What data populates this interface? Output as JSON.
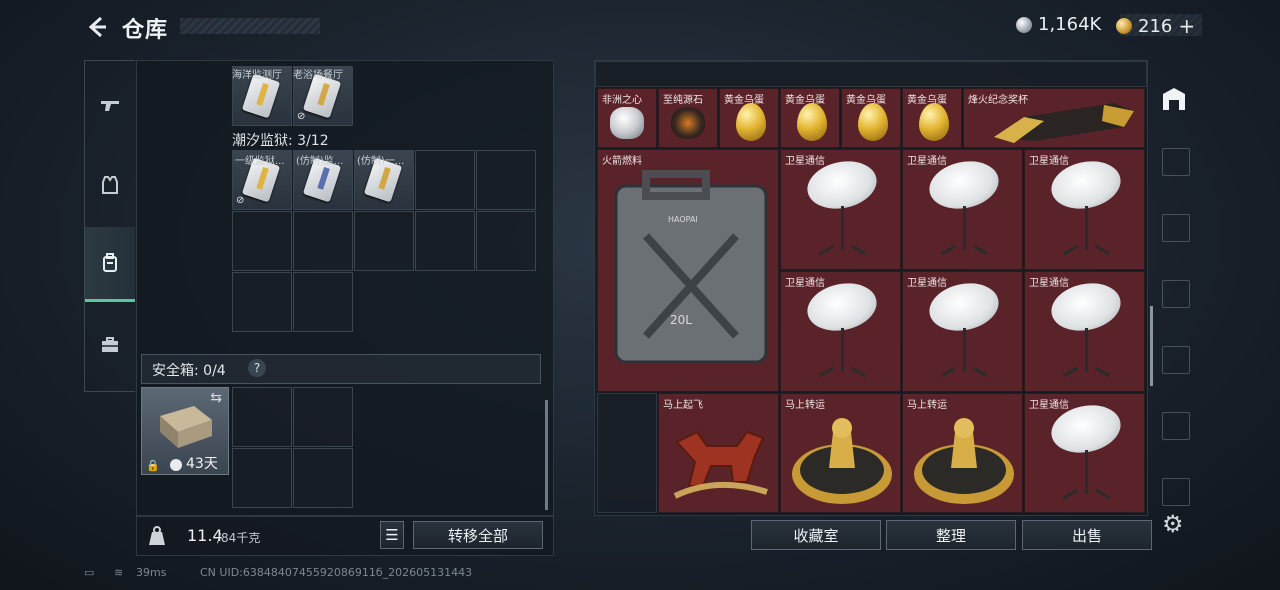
{
  "header": {
    "title": "仓库",
    "silver": "1,164K",
    "gold": "216",
    "plus": "+"
  },
  "nav": {
    "items": [
      "weapons",
      "armor",
      "backpack",
      "briefcase"
    ],
    "active": 2
  },
  "left": {
    "top_labels": [
      "海洋监测厅",
      "老浴场餐厅"
    ],
    "section": "潮汐监狱: 3/12",
    "cards": [
      "一级监狱...",
      "(仿制)监...",
      "(仿制)一..."
    ],
    "safe": "安全箱: 0/4",
    "safe_help": "?",
    "safe_days": "43天",
    "weight": "11.4",
    "weight_max": "/84千克",
    "transfer": "转移全部"
  },
  "right": {
    "top_items": [
      "非洲之心",
      "至纯源石",
      "黄金乌蛋",
      "黄金乌蛋",
      "黄金乌蛋",
      "黄金乌蛋",
      "烽火纪念奖杯"
    ],
    "fuel": "火箭燃料",
    "jerry_a": "HAOPAI",
    "jerry_b": "20L",
    "sat": "卫星通信",
    "horse": "马上起飞",
    "turntable": "马上转运",
    "buttons": [
      "收藏室",
      "整理",
      "出售"
    ]
  },
  "status": {
    "ping": "39ms",
    "uid": "CN UID:6384840745592086911б_202605131443"
  }
}
